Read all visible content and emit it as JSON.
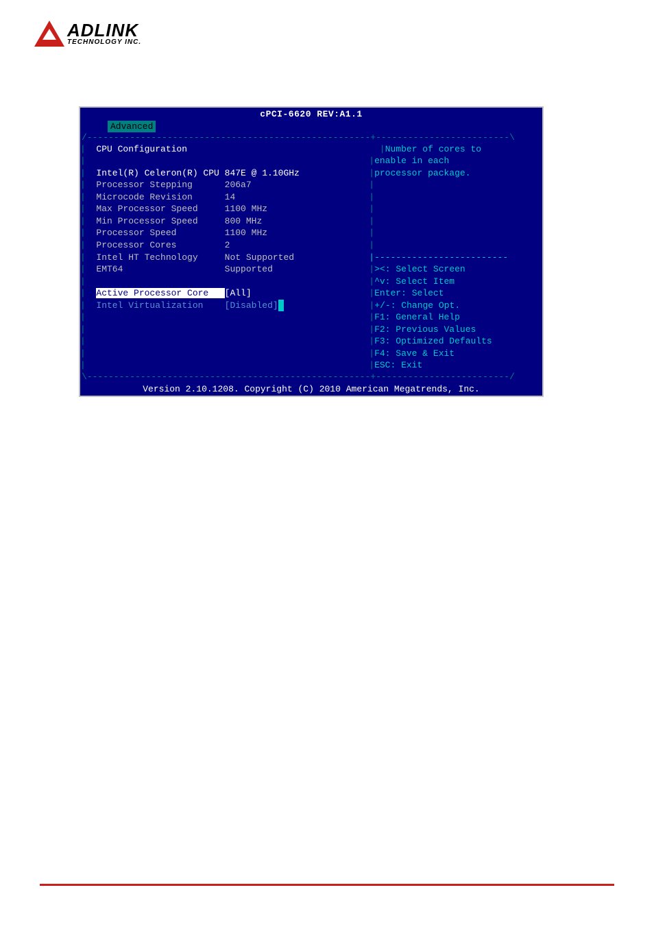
{
  "logo": {
    "main": "ADLINK",
    "sub": "TECHNOLOGY INC."
  },
  "bios": {
    "title": "cPCI-6620 REV:A1.1",
    "tab": "Advanced",
    "top_border": "/-----------------------------------------------------+-------------------------\\",
    "mid_divider": "|-------------------------",
    "bottom_border": "\\-----------------------------------------------------+-------------------------/",
    "left": {
      "heading": "CPU Configuration",
      "cpu_name": "Intel(R) Celeron(R) CPU 847E @ 1.10GHz",
      "rows": [
        {
          "label": "Processor Stepping",
          "value": "206a7"
        },
        {
          "label": "Microcode Revision",
          "value": "14"
        },
        {
          "label": "Max Processor Speed",
          "value": "1100 MHz"
        },
        {
          "label": "Min Processor Speed",
          "value": "800 MHz"
        },
        {
          "label": "Processor Speed",
          "value": "1100 MHz"
        },
        {
          "label": "Processor Cores",
          "value": "2"
        },
        {
          "label": "Intel HT Technology",
          "value": "Not Supported"
        },
        {
          "label": "EMT64",
          "value": "Supported"
        }
      ],
      "options": [
        {
          "label": "Active Processor Core",
          "value": "[All]",
          "selected": true
        },
        {
          "label": "Intel Virtualization",
          "value": "[Disabled]",
          "selected": false,
          "cursor": true
        }
      ]
    },
    "right": {
      "help_desc": [
        "Number of cores to",
        "enable in each",
        "processor package."
      ],
      "nav": [
        "><: Select Screen",
        "^v: Select Item",
        "Enter: Select",
        "+/-: Change Opt.",
        "F1: General Help",
        "F2: Previous Values",
        "F3: Optimized Defaults",
        "F4: Save & Exit",
        "ESC: Exit"
      ]
    },
    "footer": "Version 2.10.1208. Copyright (C) 2010 American Megatrends, Inc."
  }
}
